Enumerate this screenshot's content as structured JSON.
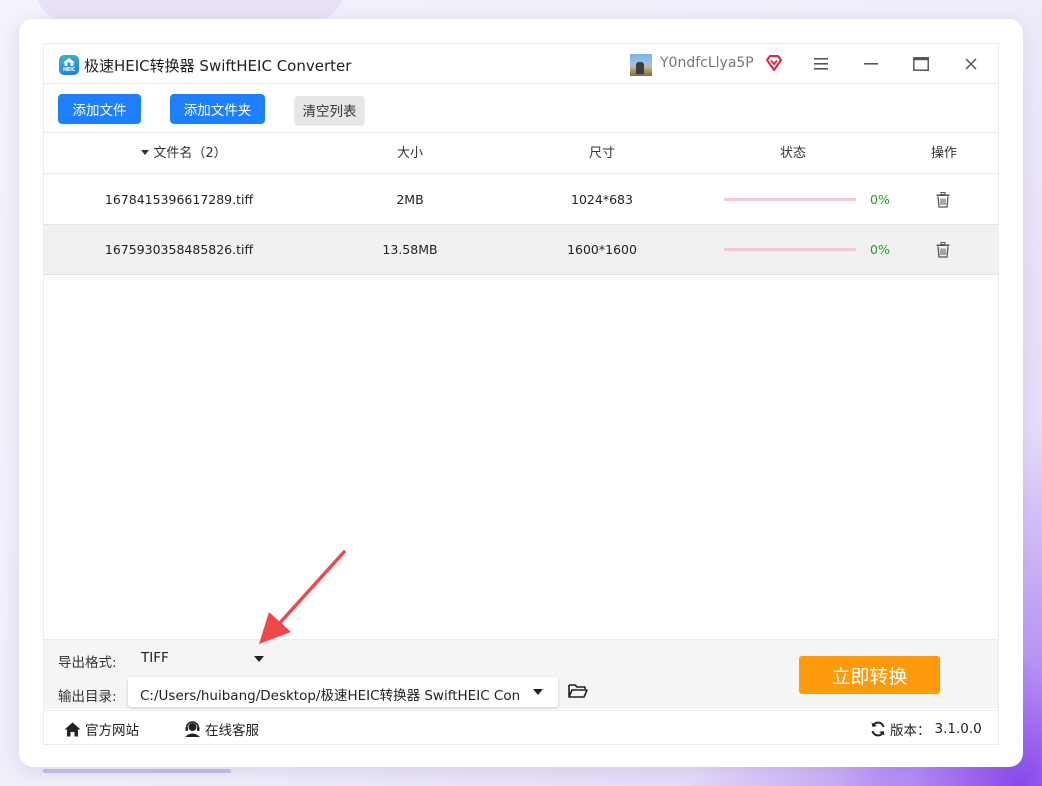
{
  "app": {
    "title": "极速HEIC转换器 SwiftHEIC Converter",
    "logo_text": "HEIC",
    "username": "Y0ndfcLlya5P"
  },
  "window_controls": {
    "menu_icon": "menu-icon",
    "minimize_icon": "minimize-icon",
    "maximize_icon": "maximize-icon",
    "close_icon": "close-icon"
  },
  "toolbar": {
    "add_file": "添加文件",
    "add_folder": "添加文件夹",
    "clear_list": "清空列表"
  },
  "table": {
    "headers": {
      "name": "文件名（2）",
      "size": "大小",
      "dimensions": "尺寸",
      "status": "状态",
      "action": "操作"
    },
    "rows": [
      {
        "name": "1678415396617289.tiff",
        "size": "2MB",
        "dimensions": "1024*683",
        "progress": "0%"
      },
      {
        "name": "1675930358485826.tiff",
        "size": "13.58MB",
        "dimensions": "1600*1600",
        "progress": "0%"
      }
    ]
  },
  "settings": {
    "format_label": "导出格式:",
    "format_value": "TIFF",
    "output_label": "输出目录:",
    "output_value": "C:/Users/huibang/Desktop/极速HEIC转换器 SwiftHEIC Converter",
    "convert_button": "立即转换"
  },
  "footer": {
    "website": "官方网站",
    "support": "在线客服",
    "version_label": "版本：",
    "version_value": "3.1.0.0"
  },
  "colors": {
    "primary_blue": "#1e80ff",
    "convert_orange": "#ff9a0d",
    "progress_pink": "#f5c6d6",
    "percent_green": "#18a318",
    "annotation_arrow": "#f04848"
  }
}
